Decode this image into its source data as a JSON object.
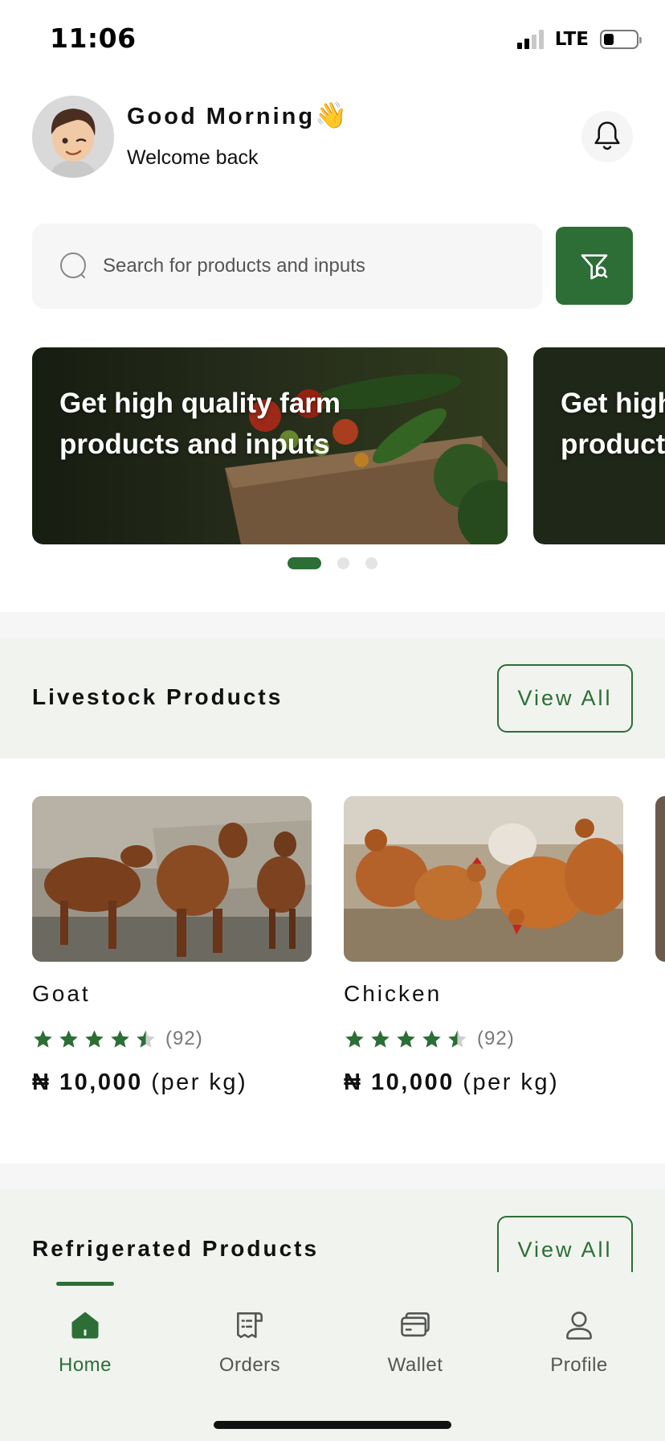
{
  "status_bar": {
    "time": "11:06",
    "network": "LTE"
  },
  "header": {
    "greeting": "Good Morning",
    "greeting_emoji": "👋",
    "subtitle": "Welcome back"
  },
  "search": {
    "placeholder": "Search for products and inputs"
  },
  "banners": [
    {
      "text": "Get high quality farm products and inputs"
    },
    {
      "text": "Get high quality farm products and inputs"
    }
  ],
  "carousel": {
    "total": 3,
    "active": 1
  },
  "sections": [
    {
      "title": "Livestock Products",
      "view_all_label": "View All"
    },
    {
      "title": "Refrigerated Products",
      "view_all_label": "View All"
    }
  ],
  "products": [
    {
      "name": "Goat",
      "rating": 4.5,
      "rating_count": "(92)",
      "currency": "₦",
      "price": "10,000",
      "unit": "(per kg)"
    },
    {
      "name": "Chicken",
      "rating": 4.5,
      "rating_count": "(92)",
      "currency": "₦",
      "price": "10,000",
      "unit": "(per kg)"
    }
  ],
  "bottom_nav": [
    {
      "label": "Home",
      "icon": "home-icon",
      "active": true
    },
    {
      "label": "Orders",
      "icon": "orders-icon",
      "active": false
    },
    {
      "label": "Wallet",
      "icon": "wallet-icon",
      "active": false
    },
    {
      "label": "Profile",
      "icon": "profile-icon",
      "active": false
    }
  ],
  "colors": {
    "brand_green": "#2c6e36",
    "section_bg": "#f0f3ee",
    "search_bg": "#f6f6f6"
  }
}
